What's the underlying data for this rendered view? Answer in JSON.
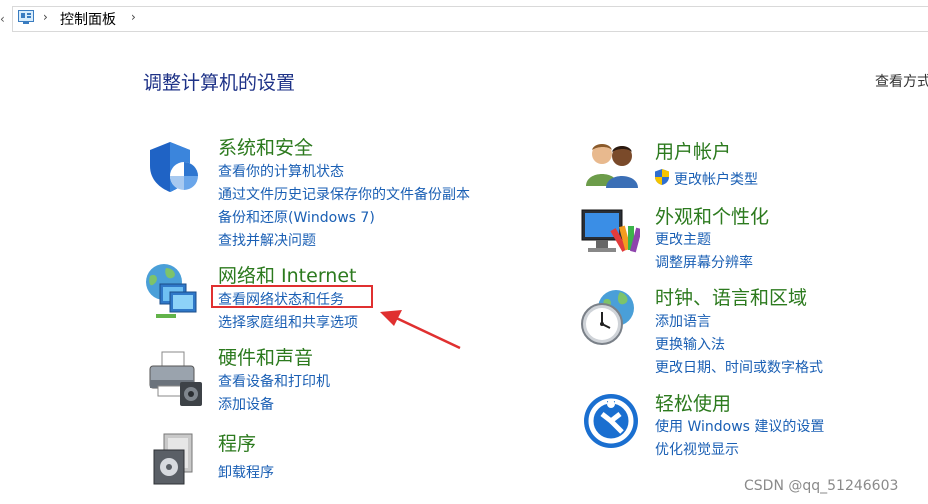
{
  "address": {
    "breadcrumb": "控制面板"
  },
  "header": {
    "title": "调整计算机的设置",
    "view_by": "查看方式"
  },
  "categories": {
    "system": {
      "title": "系统和安全",
      "links": [
        "查看你的计算机状态",
        "通过文件历史记录保存你的文件备份副本",
        "备份和还原(Windows 7)",
        "查找并解决问题"
      ]
    },
    "network": {
      "title": "网络和 Internet",
      "links": [
        "查看网络状态和任务",
        "选择家庭组和共享选项"
      ]
    },
    "hardware": {
      "title": "硬件和声音",
      "links": [
        "查看设备和打印机",
        "添加设备"
      ]
    },
    "programs": {
      "title": "程序",
      "links": [
        "卸载程序"
      ]
    },
    "users": {
      "title": "用户帐户",
      "links": [
        "更改帐户类型"
      ]
    },
    "appearance": {
      "title": "外观和个性化",
      "links": [
        "更改主题",
        "调整屏幕分辨率"
      ]
    },
    "clock": {
      "title": "时钟、语言和区域",
      "links": [
        "添加语言",
        "更换输入法",
        "更改日期、时间或数字格式"
      ]
    },
    "ease": {
      "title": "轻松使用",
      "links": [
        "使用 Windows 建议的设置",
        "优化视觉显示"
      ]
    }
  },
  "annotation": {
    "highlight_color": "#e03030"
  },
  "watermark": "CSDN @qq_51246603",
  "colors": {
    "title_blue": "#1e3287",
    "category_green": "#2c7a1e",
    "link_blue": "#1a5fb4"
  }
}
